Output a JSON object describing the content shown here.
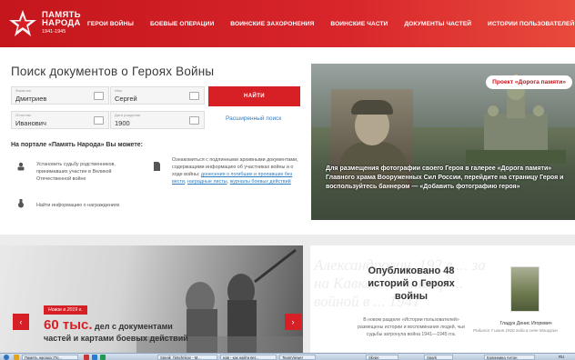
{
  "header": {
    "logo_line1": "ПАМЯТЬ",
    "logo_line2": "НАРОДА",
    "logo_years": "1941-1945",
    "menu": [
      "ГЕРОИ ВОЙНЫ",
      "БОЕВЫЕ ОПЕРАЦИИ",
      "ВОИНСКИЕ ЗАХОРОНЕНИЯ",
      "ВОИНСКИЕ ЧАСТИ",
      "ДОКУМЕНТЫ ЧАСТЕЙ",
      "ИСТОРИИ ПОЛЬЗОВАТЕЛЕЙ"
    ]
  },
  "search": {
    "title": "Поиск документов о Героях Войны",
    "surname_label": "Фамилия",
    "surname_value": "Дмитриев",
    "name_label": "Имя",
    "name_value": "Сергей",
    "patronymic_label": "Отчество",
    "patronymic_value": "Иванович",
    "birthdate_label": "Дата рождения",
    "birthdate_value": "1900",
    "find_button": "НАЙТИ",
    "advanced_link": "Расширенный поиск"
  },
  "portal": {
    "heading": "На портале «Память Народа» Вы можете:",
    "feature1": "Установить судьбу родственников, принимавших участие в Великой Отечественной войне",
    "feature2": "Найти информацию о награждениях",
    "feature3_text": "Ознакомиться с подлинными архивными документами, содержащими информацию об участниках войны и о ходе войны:",
    "feature3_link1": "донесения о погибших и пропавших без вести",
    "feature3_link2": "наградные листы",
    "feature3_link3": "журналы боевых действий"
  },
  "banner": {
    "pill": "Проект «Дорога памяти»",
    "text": "Для размещения фотографии своего Героя в галерее «Дорога памяти» Главного храма Вооруженных Сил России, перейдите на страницу Героя и воспользуйтесь баннером — «Добавить фотографию героя»"
  },
  "promo": {
    "badge": "Новое в 2019 г.",
    "big_number": "60 тыс.",
    "line1_rest": " дел с документами",
    "line2": "частей и картами боевых действий",
    "prev_arrow": "‹",
    "next_arrow": "›"
  },
  "stories": {
    "bg_script": "Александрович, 192 в ... за на Кавказе, в эпиляр ... войной в ... 1941",
    "title": "Опубликовано 48 историй о Героях войны",
    "desc": "В новом разделе «Истории пользователей» размещены истории и воспоминания людей, чьи судьбы затронула война 1941—1945 гга.",
    "hero_name": "Гладун Денис Игоревич",
    "hero_desc": "Родился 7 июня 1920 года в селе Мишурин"
  },
  "taskbar": {
    "items": [
      "Память народа::По...",
      "Speak_hitschnkov - M...",
      "нав - как найти вет...",
      "TeamViewer",
      "Skype",
      "Spark",
      "Калинкина Антон"
    ],
    "lang": "RU"
  },
  "colors": {
    "brand_red": "#d71f26",
    "link_blue": "#2e7dc2"
  }
}
